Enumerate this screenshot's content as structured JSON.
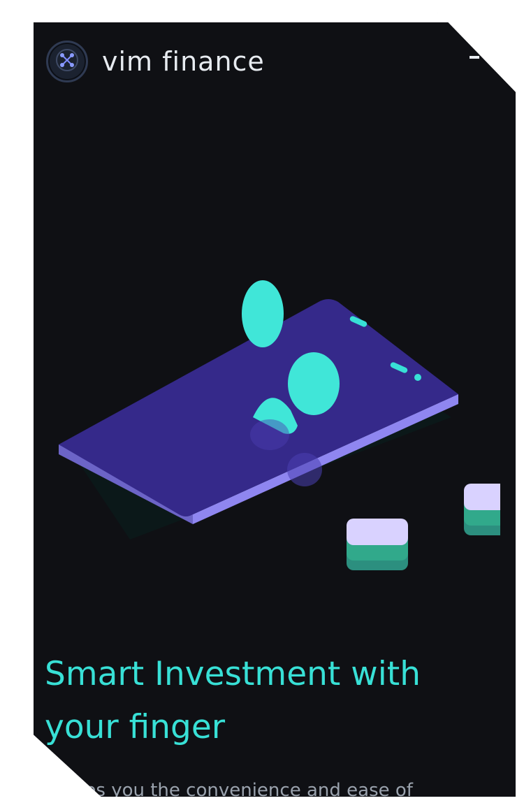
{
  "app": {
    "brand": "vim finance",
    "logo_icon": "crypto-network-icon",
    "menu_icon": "hamburger-icon"
  },
  "hero": {
    "illustration": "phone-with-coins-illustration",
    "headline": "Smart Investment with your finger",
    "subtext": "ves you the convenience and ease of"
  },
  "colors": {
    "screen_bg": "#0f1014",
    "accent_teal": "#38e0d6",
    "phone_purple": "#3a2f8f",
    "phone_edge": "#7d73d9",
    "card_lilac": "#d9d2ff",
    "card_green": "#2c8f7f",
    "text_light": "#e7ebf0",
    "text_muted": "#9aa2ad"
  }
}
